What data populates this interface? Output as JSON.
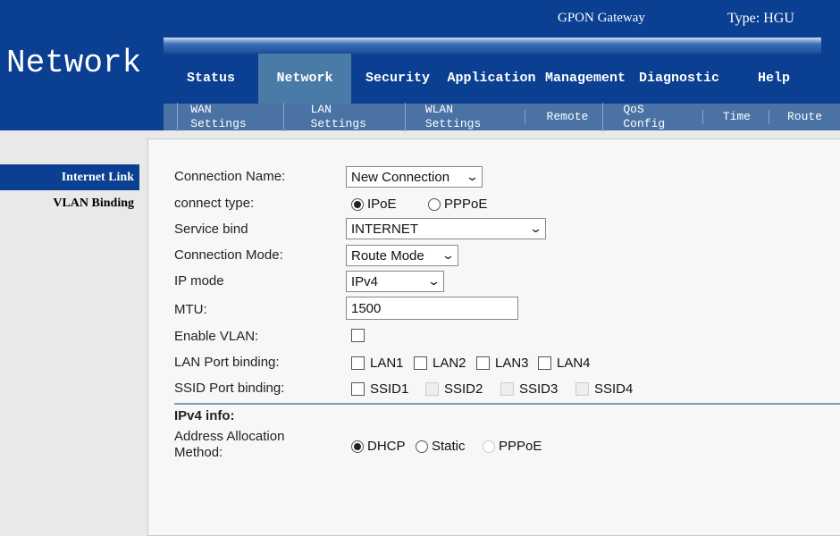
{
  "header": {
    "brand": "Network",
    "product": "GPON Gateway",
    "type": "Type: HGU"
  },
  "tabs": [
    "Status",
    "Network",
    "Security",
    "Application",
    "Management",
    "Diagnostic",
    "Help"
  ],
  "subnav": [
    "WAN Settings",
    "LAN Settings",
    "WLAN Settings",
    "Remote",
    "QoS Config",
    "Time",
    "Route"
  ],
  "sidebar": [
    "Internet Link",
    "VLAN Binding"
  ],
  "form": {
    "connection_name_label": "Connection Name:",
    "connection_name": "New Connection",
    "connect_type_label": "connect type:",
    "ipoe": "IPoE",
    "pppoe": "PPPoE",
    "service_bind_label": "Service bind",
    "service_bind": "INTERNET",
    "connection_mode_label": "Connection Mode:",
    "connection_mode": "Route Mode",
    "ip_mode_label": "IP mode",
    "ip_mode": "IPv4",
    "mtu_label": "MTU:",
    "mtu": "1500",
    "enable_vlan_label": "Enable VLAN:",
    "lan_port_label": "LAN Port binding:",
    "lan_ports": [
      "LAN1",
      "LAN2",
      "LAN3",
      "LAN4"
    ],
    "ssid_port_label": "SSID Port binding:",
    "ssids": [
      "SSID1",
      "SSID2",
      "SSID3",
      "SSID4"
    ],
    "ipv4_info": "IPv4 info:",
    "addr_method_label_1": "Address Allocation",
    "addr_method_label_2": "Method:",
    "dhcp": "DHCP",
    "static": "Static",
    "pppoe2": "PPPoE"
  }
}
